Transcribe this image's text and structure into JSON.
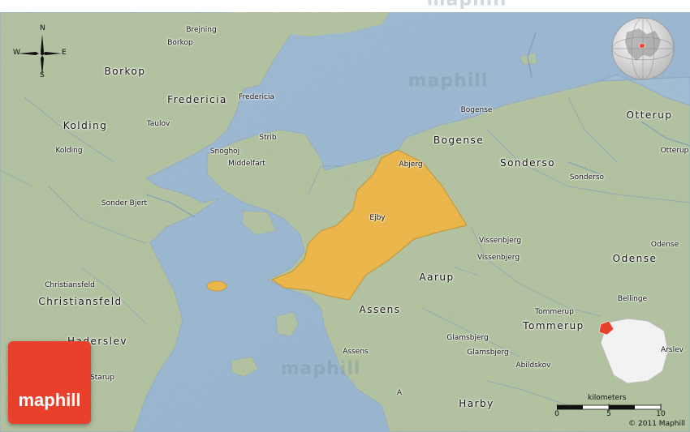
{
  "map": {
    "region_color": "#f4bd4e",
    "land_color": "#b9c9a6",
    "water_color": "#a8c3dc",
    "labels": {
      "bogense_major": "Bogense",
      "sonderso_major": "Sonderso",
      "otterup_major": "Otterup",
      "odense_major": "Odense",
      "kolding_major": "Kolding",
      "borkop_major": "Borkop",
      "fredericia_major": "Fredericia",
      "christiansfeld_major": "Christiansfeld",
      "haderslev_major": "Haderslev",
      "aarup_major": "Aarup",
      "assens_major": "Assens",
      "tommerup_major": "Tommerup",
      "harby_major": "Harby",
      "brejning": "Brejning",
      "borkop_minor": "Borkop",
      "fredericia_minor": "Fredericia",
      "taulov": "Taulov",
      "kolding_minor": "Kolding",
      "strib": "Strib",
      "snoghoj": "Snoghoj",
      "middelfart": "Middelfart",
      "sonder_bjert": "Sonder Bjert",
      "christiansfeld_minor": "Christiansfeld",
      "bogense_minor": "Bogense",
      "abjerg": "Abjerg",
      "ejby": "Ejby",
      "sonderso_minor": "Sonderso",
      "otterup_minor": "Otterup",
      "odense_minor": "Odense",
      "vissenbjerg_1": "Vissenbjerg",
      "vissenbjerg_2": "Vissenbjerg",
      "tommerup_minor": "Tommerup",
      "bellinge": "Bellinge",
      "glamsbjerg_1": "Glamsbjerg",
      "glamsbjerg_2": "Glamsbjerg",
      "assens_minor": "Assens",
      "abildskov": "Abildskov",
      "arslev": "Arslev",
      "starup": "Starup",
      "a_point": "A"
    },
    "watermarks": [
      "maphill",
      "maphill",
      "maphill"
    ]
  },
  "compass": {
    "north": "N",
    "south": "S",
    "east": "E",
    "west": "W"
  },
  "logo": {
    "text": "maphill"
  },
  "scale": {
    "title": "kilometers",
    "ticks": [
      "0",
      "5",
      "10"
    ]
  },
  "copyright": "© 2011 Maphill"
}
